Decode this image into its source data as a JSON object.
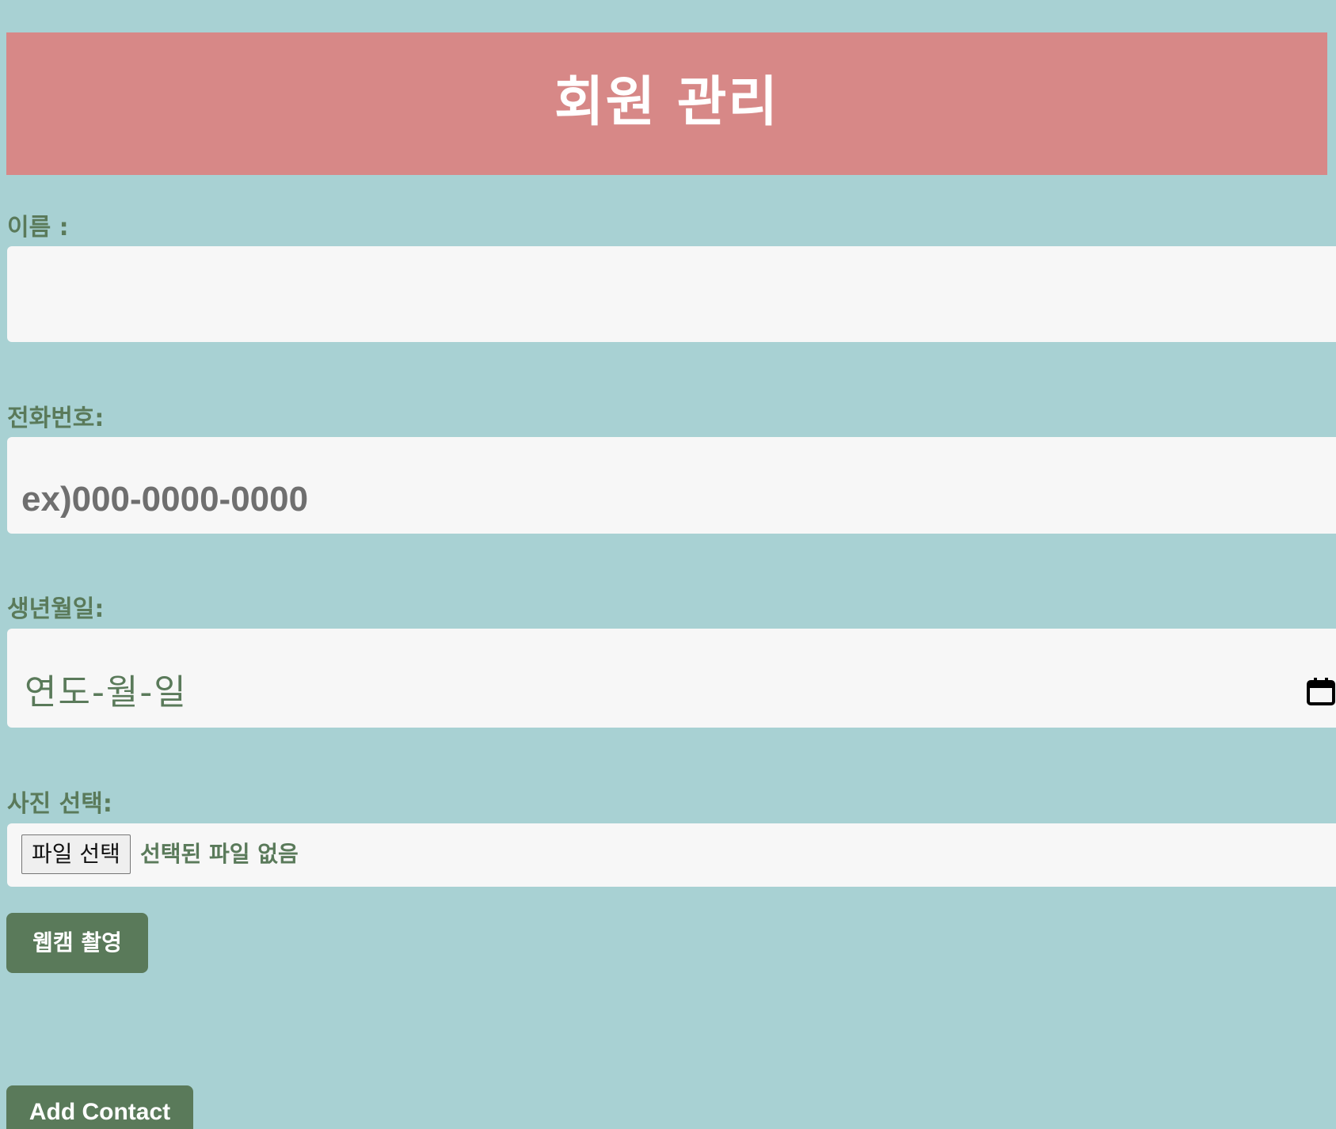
{
  "header": {
    "title": "회원 관리"
  },
  "form": {
    "name": {
      "label": "이름 :",
      "value": "",
      "placeholder": ""
    },
    "phone": {
      "label": "전화번호:",
      "value": "",
      "placeholder": "ex)000-0000-0000"
    },
    "birthdate": {
      "label": "생년월일:",
      "display": "연도-월-일",
      "icon": "calendar-icon"
    },
    "photo": {
      "label": "사진 선택:",
      "button_label": "파일 선택",
      "status": "선택된 파일 없음"
    }
  },
  "buttons": {
    "webcam": "웹캠 촬영",
    "add_contact": "Add Contact"
  },
  "colors": {
    "background": "#a8d1d3",
    "header": "#d78887",
    "accent": "#5a7a5a",
    "field": "#f7f7f7"
  }
}
